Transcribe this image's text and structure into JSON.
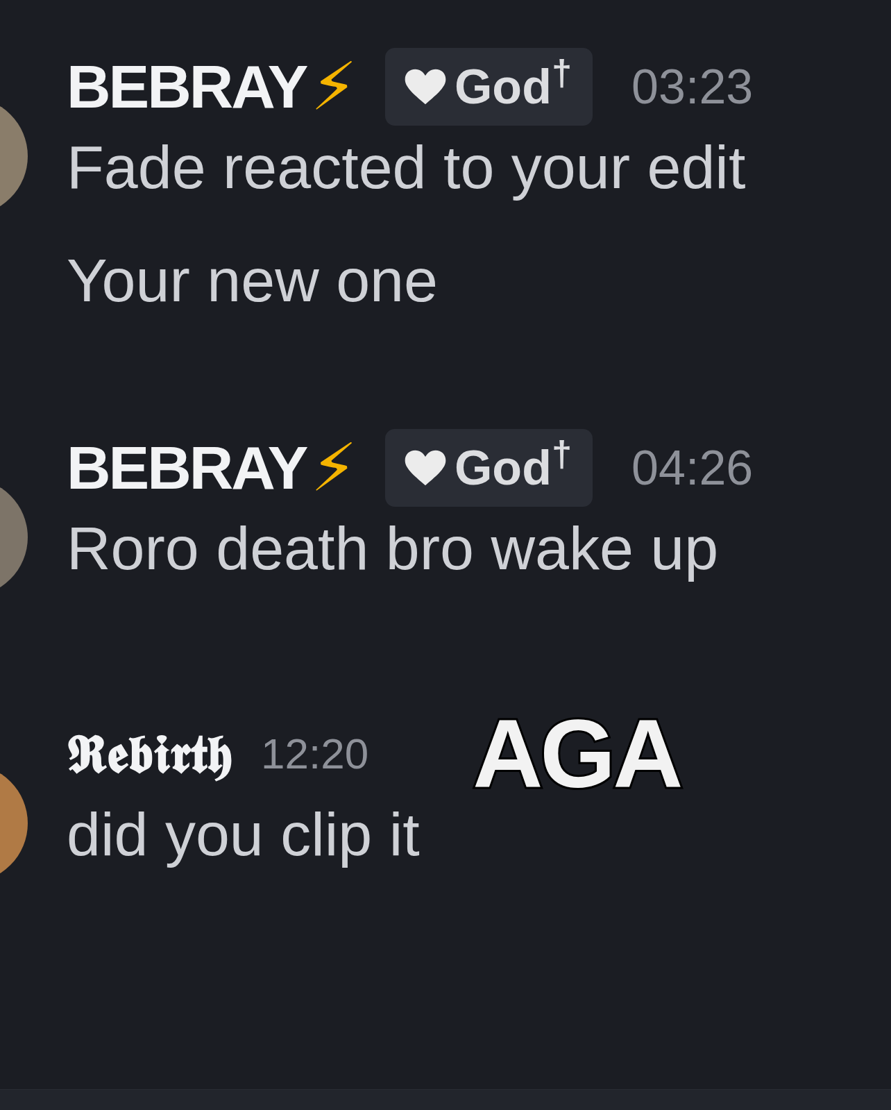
{
  "messages": [
    {
      "author": "BEBRAY",
      "emoji": "⚡",
      "badge": "God$^{†}$",
      "time": "03:23",
      "lines": [
        "Fade reacted to your edit",
        "Your new one"
      ],
      "avatar": {
        "color": "#8a7d6a"
      }
    },
    {
      "author": "BEBRAY",
      "emoji": "⚡",
      "badge": "God$^{†}$",
      "time": "04:26",
      "lines": [
        "Roro death bro wake up"
      ],
      "avatar": {
        "color": "#7d7468"
      }
    },
    {
      "author": "𝕽𝖊𝖇𝖎𝖗𝖙𝖍",
      "time": "12:20",
      "lines": [
        "did you clip it"
      ],
      "sticker": "AGA",
      "avatar": {
        "color": "#b07a45"
      }
    }
  ]
}
